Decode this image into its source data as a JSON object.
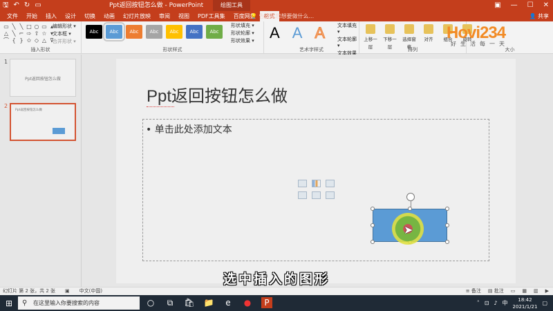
{
  "titlebar": {
    "doc_title": "Ppt返回按钮怎么做 - PowerPoint",
    "contextual_tool": "绘图工具",
    "qat": [
      "save-icon",
      "undo-icon",
      "redo-icon",
      "present-icon"
    ],
    "window_buttons": [
      "ribbon-options-icon",
      "minimize-icon",
      "maximize-icon",
      "close-icon"
    ]
  },
  "tabs": [
    "文件",
    "开始",
    "插入",
    "设计",
    "切换",
    "动画",
    "幻灯片放映",
    "审阅",
    "视图",
    "PDF工具集",
    "百度网盘",
    "格式"
  ],
  "active_tab": "格式",
  "tell_me": "告诉我您想要做什么...",
  "share": "共享",
  "ribbon": {
    "insert_shapes": {
      "label": "插入形状",
      "edit_shape": "编辑形状 ▾",
      "text_box": "文本框 ▾",
      "merge_shapes": "合并形状 ▾"
    },
    "shape_styles": {
      "label": "形状样式",
      "swatches": [
        {
          "text": "Abc",
          "color": "#000000"
        },
        {
          "text": "Abc",
          "color": "#5b9bd5"
        },
        {
          "text": "Abc",
          "color": "#ed7d31"
        },
        {
          "text": "Abc",
          "color": "#a5a5a5"
        },
        {
          "text": "Abc",
          "color": "#ffc000"
        },
        {
          "text": "Abc",
          "color": "#4472c4"
        },
        {
          "text": "Abc",
          "color": "#70ad47"
        }
      ],
      "fill": "形状填充 ▾",
      "outline": "形状轮廓 ▾",
      "effects": "形状效果 ▾"
    },
    "wordart": {
      "label": "艺术字样式",
      "samples": [
        "A",
        "A",
        "A"
      ],
      "text_fill": "文本填充 ▾",
      "text_outline": "文本轮廓 ▾",
      "text_effects": "文本效果 ▾"
    },
    "arrange": {
      "label": "排列",
      "items": [
        "上移一层",
        "下移一层",
        "选择窗格",
        "对齐",
        "组合",
        "旋转"
      ]
    },
    "size": {
      "label": "大小"
    }
  },
  "watermark": {
    "logo": "Hovi234",
    "sub": "好生活每一天"
  },
  "slides": [
    {
      "number": "1",
      "title": "Ppt返回按钮怎么做"
    },
    {
      "number": "2",
      "title": "Ppt返回按钮怎么做"
    }
  ],
  "slide": {
    "title": "Ppt返回按钮怎么做",
    "bullet": "• 单击此处添加文本"
  },
  "caption": "选中插入的图形",
  "status": {
    "slide_info": "幻灯片 第 2 张，共 2 张",
    "language": "中文(中国)",
    "notes": "备注",
    "comments": "批注"
  },
  "taskbar": {
    "search_placeholder": "在这里输入你要搜索的内容",
    "time": "18:42",
    "date": "2021/1/21",
    "ime": "中"
  }
}
